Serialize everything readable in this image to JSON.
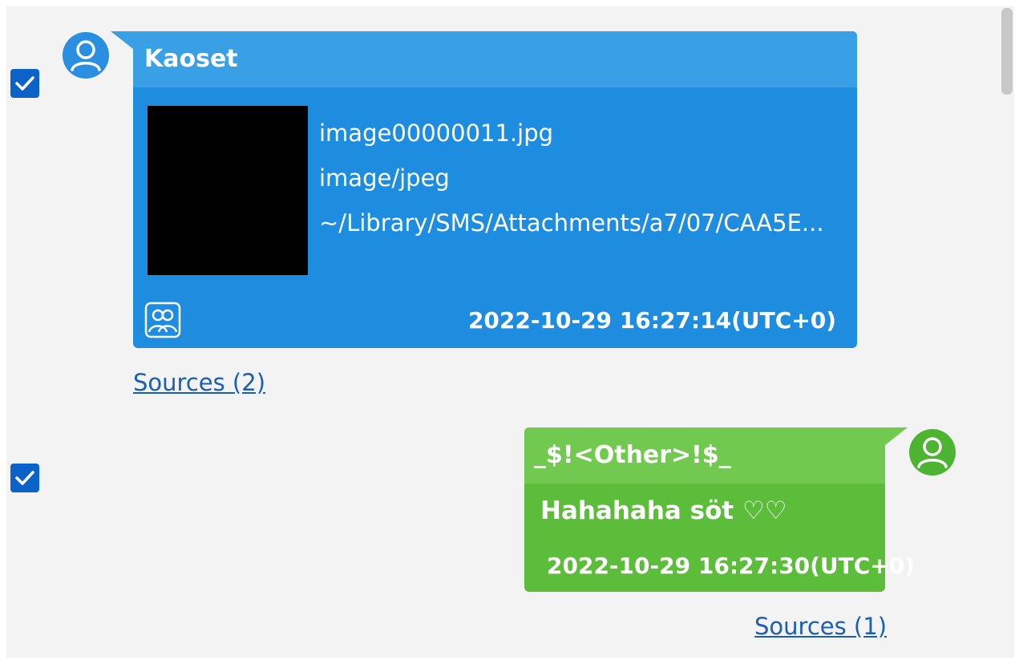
{
  "messages": [
    {
      "checked": true,
      "sender": "Kaoset",
      "attachment": {
        "filename": "image00000011.jpg",
        "mime_type": "image/jpeg",
        "path": "~/Library/SMS/Attachments/a7/07/CAA5E..."
      },
      "timestamp": "2022-10-29 16:27:14(UTC+0)",
      "sources_label": "Sources (2)"
    },
    {
      "checked": true,
      "sender": "_$!<Other>!$_",
      "text": "Hahahaha söt ♡♡",
      "timestamp": "2022-10-29 16:27:30(UTC+0)",
      "sources_label": "Sources (1)"
    }
  ],
  "icons": {
    "checkbox": "checkmark-icon",
    "incoming_avatar": "user-avatar-icon",
    "outgoing_avatar": "user-avatar-icon",
    "group": "contacts-icon"
  },
  "colors": {
    "incoming_bubble": "#1e8de0",
    "incoming_header": "#3aa0e6",
    "outgoing_bubble": "#5bbd3a",
    "outgoing_header": "#72c94f",
    "checkbox": "#0b63c9",
    "link": "#1a5fb4",
    "background": "#f3f3f3"
  }
}
